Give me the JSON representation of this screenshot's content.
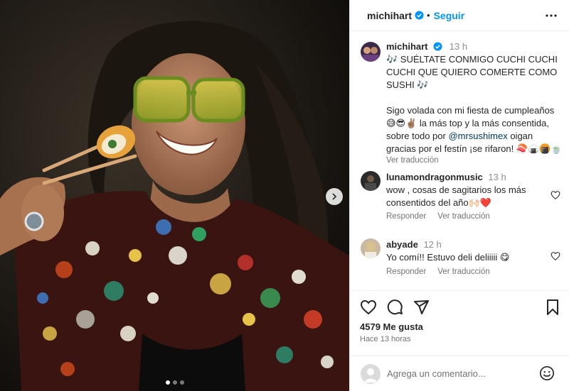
{
  "post": {
    "author": "michihart",
    "follow_label": "Seguir",
    "separator": "•",
    "caption": {
      "username": "michihart",
      "time": "13 h",
      "line1": "🎶 SUÉLTATE CONMIGO CUCHI CUCHI CUCHI QUE QUIERO COMERTE COMO SUSHI 🎶",
      "line2_before": "Sigo volada con mi fiesta de cumpleaños 😅😎✌🏽 la más top y la más consentida, sobre todo por ",
      "mention": "@mrsushimex",
      "line2_after": " oigan gracias por el festín ¡se rifaron! 🍣🍙🍘🍵",
      "translate": "Ver traducción"
    }
  },
  "comments": [
    {
      "username": "lunamondragonmusic",
      "time": "13 h",
      "text": "wow , cosas de sagitarios los más consentidos del año🙌🏻❤️",
      "reply": "Responder",
      "translate": "Ver traducción"
    },
    {
      "username": "abyade",
      "time": "12 h",
      "text": "Yo comí!! Estuvo deli deliiiii 😋",
      "reply": "Responder",
      "translate": "Ver traducción"
    }
  ],
  "stats": {
    "likes": "4579 Me gusta",
    "ago": "Hace 13 horas"
  },
  "add_comment": {
    "placeholder": "Agrega un comentario..."
  },
  "carousel": {
    "current": 1,
    "total": 3
  },
  "icons": {
    "more": "more-horizontal-icon",
    "verified": "verified-badge-icon",
    "like": "heart-icon",
    "comment": "comment-icon",
    "share": "share-icon",
    "save": "bookmark-icon",
    "emoji": "emoji-icon",
    "next": "chevron-right-icon"
  },
  "colors": {
    "accent": "#0095f6",
    "mention": "#00376b",
    "secondary_text": "#737373"
  }
}
